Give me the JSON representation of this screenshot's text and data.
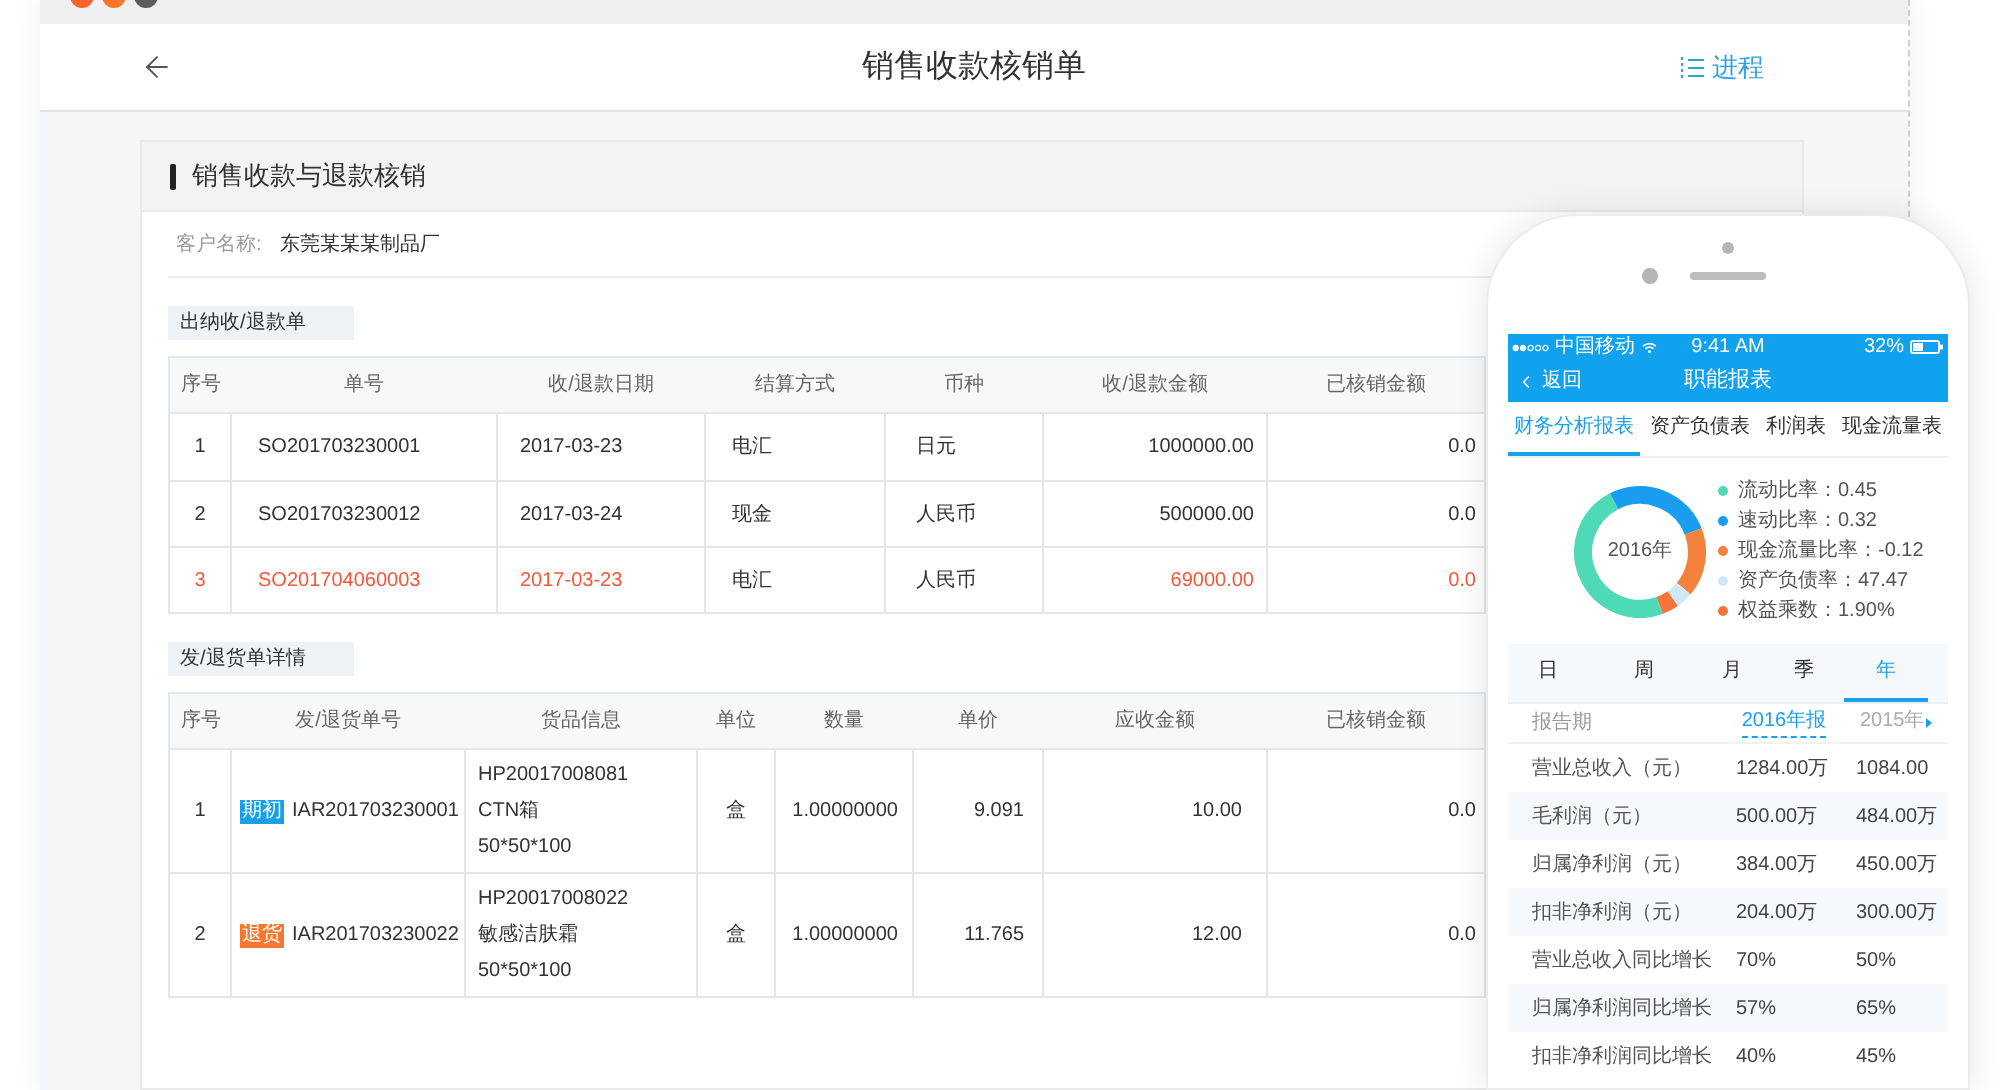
{
  "window": {
    "title": "销售收款核销单",
    "action": "进程"
  },
  "panel": {
    "title": "销售收款与退款核销",
    "customer": {
      "label": "客户名称:",
      "value": "东莞某某某制品厂"
    },
    "receipts": {
      "title": "出纳收/退款单",
      "columns": [
        "序号",
        "单号",
        "收/退款日期",
        "结算方式",
        "币种",
        "收/退款金额",
        "已核销金额"
      ],
      "rows": [
        {
          "alert": false,
          "cells": [
            "1",
            "SO201703230001",
            "2017-03-23",
            "电汇",
            "日元",
            "1000000.00",
            "0.0"
          ]
        },
        {
          "alert": false,
          "cells": [
            "2",
            "SO201703230012",
            "2017-03-24",
            "现金",
            "人民币",
            "500000.00",
            "0.0"
          ]
        },
        {
          "alert": true,
          "cells": [
            "3",
            "SO201704060003",
            "2017-03-23",
            "电汇",
            "人民币",
            "69000.00",
            "0.0"
          ]
        }
      ]
    },
    "shipments": {
      "title": "发/退货单详情",
      "columns": [
        "序号",
        "发/退货单号",
        "货品信息",
        "单位",
        "数量",
        "单价",
        "应收金额",
        "已核销金额"
      ],
      "rows": [
        {
          "index": "1",
          "tag": {
            "label": "期初",
            "color": "#1a9fe6"
          },
          "order": "IAR201703230001",
          "goods": {
            "code": "HP20017008081",
            "name": "CTN箱",
            "size": "50*50*100"
          },
          "unit": "盒",
          "quantity": "1.00000000",
          "price": "9.091",
          "receivable": "10.00",
          "written_off": "0.0"
        },
        {
          "index": "2",
          "tag": {
            "label": "退货",
            "color": "#f7782e"
          },
          "order": "IAR201703230022",
          "goods": {
            "code": "HP20017008022",
            "name": "敏感洁肤霜",
            "size": "50*50*100"
          },
          "unit": "盒",
          "quantity": "1.00000000",
          "price": "11.765",
          "receivable": "12.00",
          "written_off": "0.0"
        }
      ]
    }
  },
  "phone": {
    "status_bar": {
      "carrier": "中国移动",
      "time": "9:41 AM",
      "battery": "32%"
    },
    "nav": {
      "back": "返回",
      "title": "职能报表"
    },
    "tabs": [
      {
        "label": "财务分析报表",
        "selected": true
      },
      {
        "label": "资产负债表",
        "selected": false
      },
      {
        "label": "利润表",
        "selected": false
      },
      {
        "label": "现金流量表",
        "selected": false
      }
    ],
    "chart": {
      "center_label": "2016年",
      "legend": [
        {
          "label": "流动比率：0.45",
          "color": "#4fdab7"
        },
        {
          "label": "速动比率：0.32",
          "color": "#1a9df0"
        },
        {
          "label": "现金流量比率：-0.12",
          "color": "#f5813f"
        },
        {
          "label": "资产负债率：47.47",
          "color": "#cfe8f6"
        },
        {
          "label": "权益乘数：1.90%",
          "color": "#f5763a"
        }
      ]
    },
    "periods": [
      {
        "label": "日",
        "selected": false
      },
      {
        "label": "周",
        "selected": false
      },
      {
        "label": "月",
        "selected": false
      },
      {
        "label": "季",
        "selected": false
      },
      {
        "label": "年",
        "selected": true
      }
    ],
    "report": {
      "label": "报告期",
      "columns": [
        {
          "label": "2016年报",
          "selected": true
        },
        {
          "label": "2015年",
          "selected": false
        }
      ],
      "rows": [
        {
          "label": "营业总收入（元）",
          "values": [
            "1284.00万",
            "1084.00"
          ]
        },
        {
          "label": "毛利润（元）",
          "values": [
            "500.00万",
            "484.00万"
          ]
        },
        {
          "label": "归属净利润（元）",
          "values": [
            "384.00万",
            "450.00万"
          ]
        },
        {
          "label": "扣非净利润（元）",
          "values": [
            "204.00万",
            "300.00万"
          ]
        },
        {
          "label": "营业总收入同比增长",
          "values": [
            "70%",
            "50%"
          ]
        },
        {
          "label": "归属净利润同比增长",
          "values": [
            "57%",
            "65%"
          ]
        },
        {
          "label": "扣非净利润同比增长",
          "values": [
            "40%",
            "45%"
          ]
        }
      ]
    }
  }
}
